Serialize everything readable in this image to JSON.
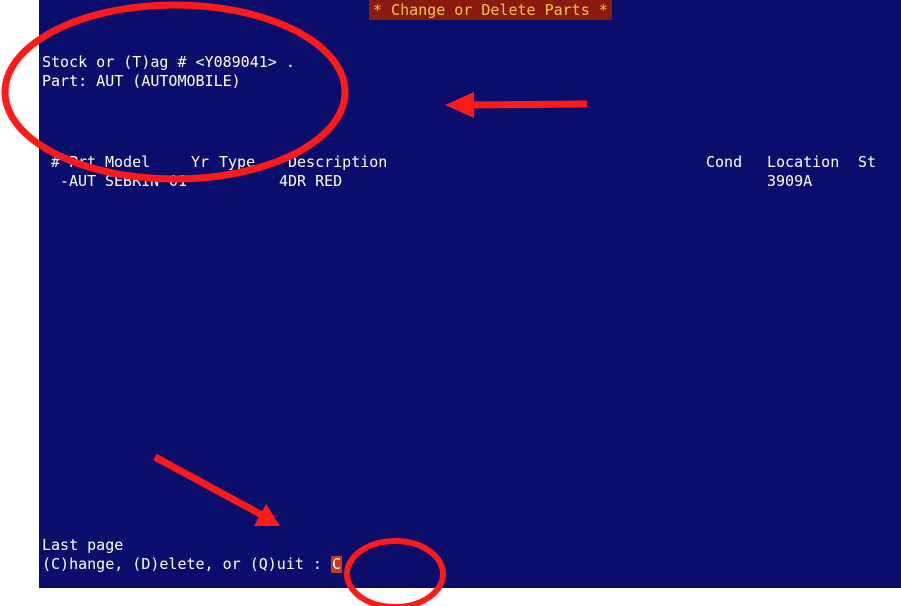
{
  "title": "* Change or Delete Parts *",
  "prompt_stock": "Stock or (T)ag # <Y089041> .",
  "part_line": "Part: AUT (AUTOMOBILE)",
  "columns": {
    "num": "#",
    "prt": "Prt",
    "model": "Model",
    "yr": "Yr",
    "type": "Type",
    "description": "Description",
    "cond": "Cond",
    "location": "Location",
    "st": "St"
  },
  "rows": [
    {
      "prefix": "-",
      "prt": "AUT",
      "model": "SEBRIN",
      "yr": "01",
      "type": "",
      "description": "4DR RED",
      "cond": "",
      "location": "3909A",
      "st": ""
    }
  ],
  "status_line": "Last page",
  "command_prompt": "(C)hange, (D)elete, or (Q)uit :",
  "command_input": "C",
  "colors": {
    "terminal_bg": "#0a0d6b",
    "text": "#ffffff",
    "title_bg": "#8b1a0e",
    "title_fg": "#f4c64a",
    "annotation": "#ff1a1a",
    "cursor_bg": "#c43b1a"
  }
}
